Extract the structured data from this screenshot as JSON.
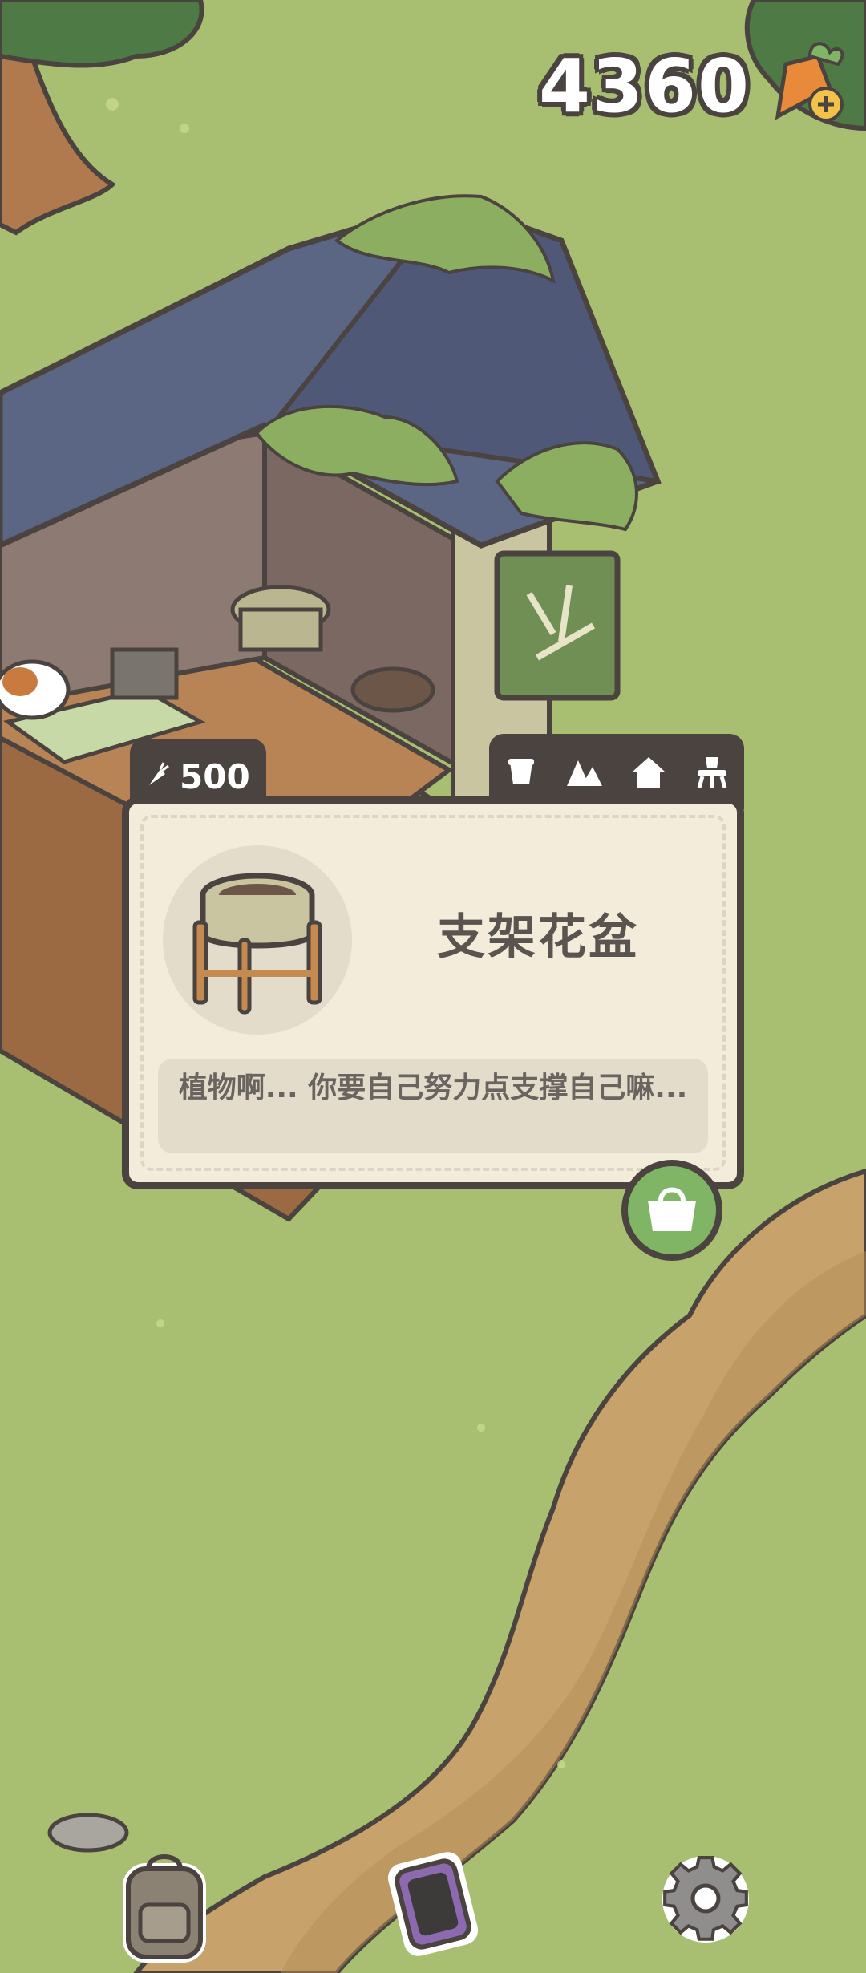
{
  "currency": {
    "value": "4360",
    "icon": "carrot-plus-icon"
  },
  "item_card": {
    "price": "500",
    "price_icon": "carrot-icon",
    "category_tabs": [
      {
        "icon": "pot-icon"
      },
      {
        "icon": "mountains-icon"
      },
      {
        "icon": "house-icon"
      },
      {
        "icon": "stool-icon"
      }
    ],
    "name": "支架花盆",
    "description": "植物啊... 你要自己努力点支撑自己嘛...",
    "buy_icon": "shopping-bag-icon"
  },
  "bottom_bar": [
    {
      "icon": "backpack-icon"
    },
    {
      "icon": "phone-icon"
    },
    {
      "icon": "gear-icon"
    }
  ],
  "colors": {
    "grass": "#a8bf72",
    "path": "#c7a26a",
    "card_border": "#4a4340",
    "card_bg": "#f3ecda",
    "buy_green": "#7fb564"
  }
}
